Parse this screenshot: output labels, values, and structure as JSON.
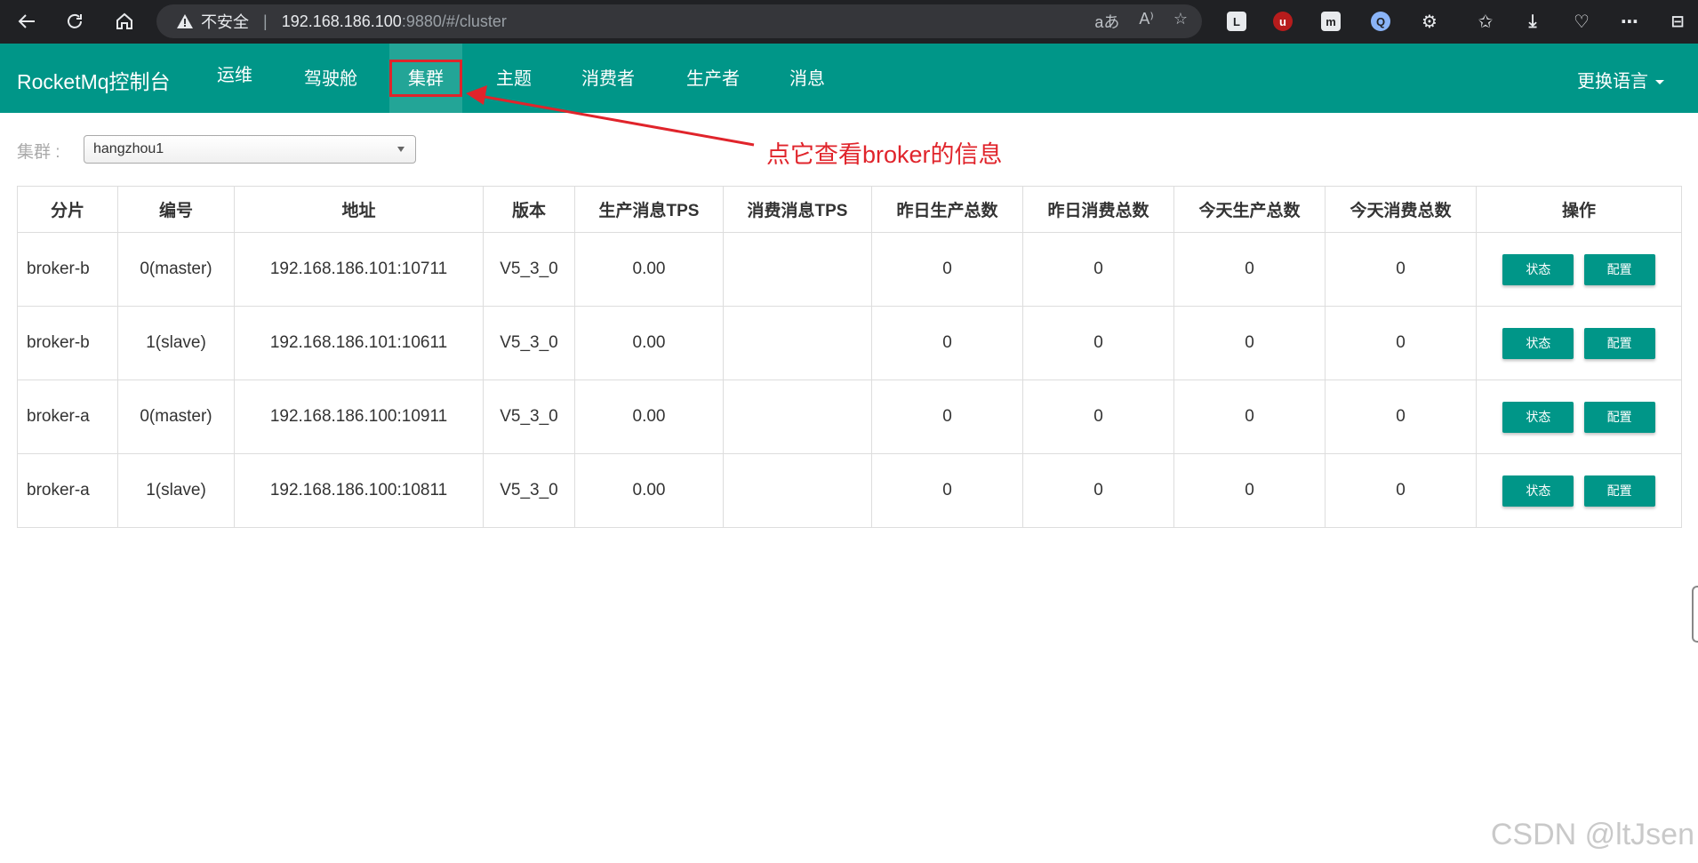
{
  "browser": {
    "back_icon": "arrow-left-icon",
    "reload_icon": "reload-icon",
    "home_icon": "home-icon",
    "security_label": "不安全",
    "url_host": "192.168.186.100",
    "url_rest": ":9880/#/cluster"
  },
  "navbar": {
    "brand": "RocketMq控制台",
    "items": [
      {
        "label": "运维"
      },
      {
        "label": "驾驶舱"
      },
      {
        "label": "集群"
      },
      {
        "label": "主题"
      },
      {
        "label": "消费者"
      },
      {
        "label": "生产者"
      },
      {
        "label": "消息"
      }
    ],
    "active_index": 2,
    "language_label": "更换语言",
    "color": "#009688"
  },
  "annotation": {
    "text": "点它查看broker的信息",
    "color": "#e0242b"
  },
  "cluster_select": {
    "label": "集群 :",
    "value": "hangzhou1"
  },
  "table": {
    "headers": [
      "分片",
      "编号",
      "地址",
      "版本",
      "生产消息TPS",
      "消费消息TPS",
      "昨日生产总数",
      "昨日消费总数",
      "今天生产总数",
      "今天消费总数",
      "操作"
    ],
    "rows": [
      {
        "broker": "broker-b",
        "id": "0(master)",
        "address": "192.168.186.101:10711",
        "version": "V5_3_0",
        "produce_tps": "0.00",
        "consume_tps": "",
        "yesterday_produce": "0",
        "yesterday_consume": "0",
        "today_produce": "0",
        "today_consume": "0"
      },
      {
        "broker": "broker-b",
        "id": "1(slave)",
        "address": "192.168.186.101:10611",
        "version": "V5_3_0",
        "produce_tps": "0.00",
        "consume_tps": "",
        "yesterday_produce": "0",
        "yesterday_consume": "0",
        "today_produce": "0",
        "today_consume": "0"
      },
      {
        "broker": "broker-a",
        "id": "0(master)",
        "address": "192.168.186.100:10911",
        "version": "V5_3_0",
        "produce_tps": "0.00",
        "consume_tps": "",
        "yesterday_produce": "0",
        "yesterday_consume": "0",
        "today_produce": "0",
        "today_consume": "0"
      },
      {
        "broker": "broker-a",
        "id": "1(slave)",
        "address": "192.168.186.100:10811",
        "version": "V5_3_0",
        "produce_tps": "0.00",
        "consume_tps": "",
        "yesterday_produce": "0",
        "yesterday_consume": "0",
        "today_produce": "0",
        "today_consume": "0"
      }
    ],
    "status_button": "状态",
    "config_button": "配置"
  },
  "watermark": "CSDN @ltJsen"
}
